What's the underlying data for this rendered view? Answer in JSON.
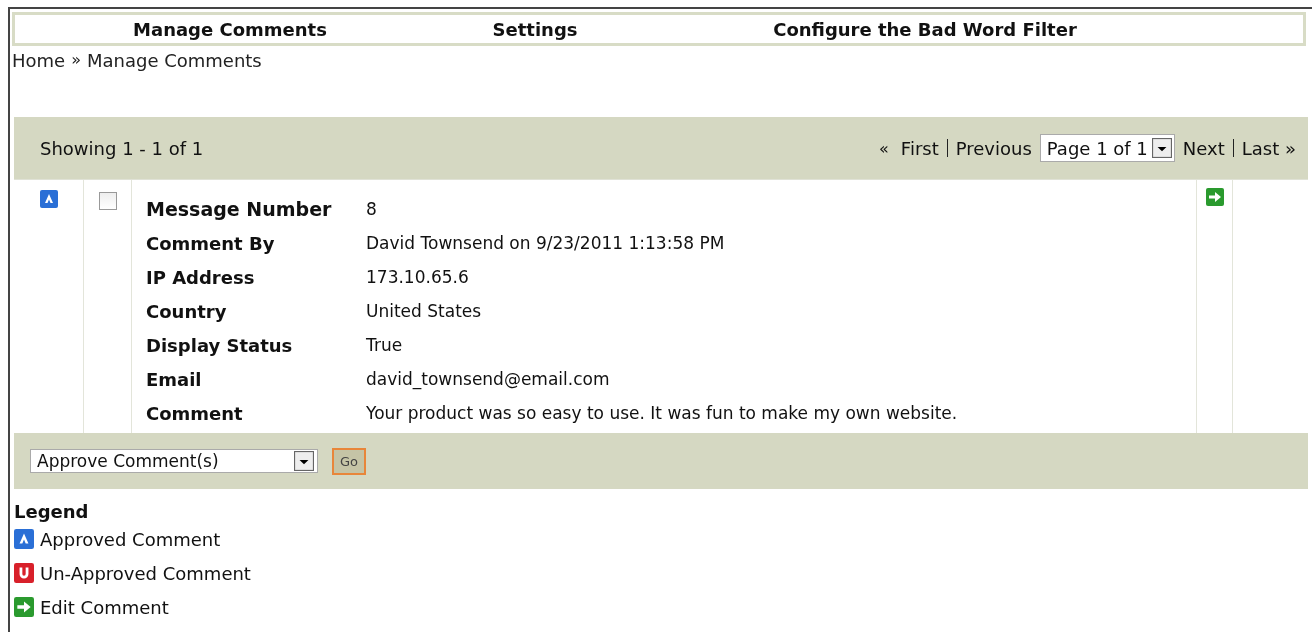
{
  "nav": [
    {
      "label": "Manage Comments"
    },
    {
      "label": "Settings"
    },
    {
      "label": "Configure the Bad Word Filter"
    }
  ],
  "breadcrumb": {
    "home": "Home",
    "separator": "»",
    "current": "Manage Comments"
  },
  "pager": {
    "showing": "Showing 1 - 1 of 1",
    "first_arrow": "«",
    "first": "First",
    "previous": "Previous",
    "page": "Page 1 of 1",
    "next": "Next",
    "last": "Last »"
  },
  "comments": [
    {
      "approved": true,
      "checked": false,
      "fields": [
        {
          "label": "Message Number",
          "value": "8"
        },
        {
          "label": "Comment By",
          "value": "David Townsend on 9/23/2011 1:13:58 PM"
        },
        {
          "label": "IP Address",
          "value": "173.10.65.6"
        },
        {
          "label": "Country",
          "value": "United States"
        },
        {
          "label": "Display Status",
          "value": "True"
        },
        {
          "label": "Email",
          "value": "david_townsend@email.com"
        },
        {
          "label": "Comment",
          "value": "Your product was so easy to use. It was fun to make my own website."
        }
      ]
    }
  ],
  "action": {
    "value": "Approve Comment(s)",
    "button": "Go"
  },
  "legend": {
    "title": "Legend",
    "items": [
      {
        "kind": "approved",
        "label": "Approved Comment"
      },
      {
        "kind": "unapproved",
        "label": "Un-Approved Comment"
      },
      {
        "kind": "edit",
        "label": "Edit Comment"
      }
    ]
  }
}
